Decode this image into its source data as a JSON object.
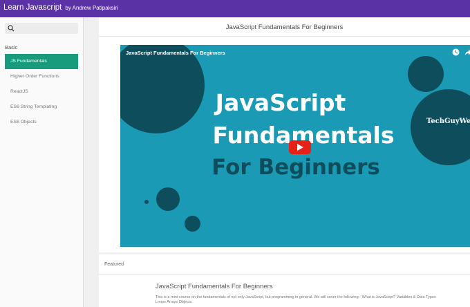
{
  "header": {
    "title": "Learn Javascript",
    "author": "by Andrew Patipaksiri"
  },
  "sidebar": {
    "search_placeholder": "",
    "section_label": "Basic",
    "items": [
      {
        "label": "JS Fundamentals",
        "active": true
      },
      {
        "label": "Higher Order Functions",
        "active": false
      },
      {
        "label": "ReactJS",
        "active": false
      },
      {
        "label": "ES6 String Templating",
        "active": false
      },
      {
        "label": "ES6 Objects",
        "active": false
      }
    ]
  },
  "main": {
    "page_title": "JavaScript Fundamentals For Beginners",
    "video": {
      "title": "JavaScript Fundamentals For Beginners",
      "thumbnail_lines": [
        "JavaScript",
        "Fundamentals",
        "For Beginners"
      ],
      "brand": "TechGuyWeb"
    },
    "featured": {
      "label": "Featured",
      "title": "JavaScript Fundamentals For Beginners",
      "description": "This is a mini-course on the fundamentals of not only JavaScript, but programming in general. We will cover the following - What is JavaScript? Variables & Data Types Loops Arrays Objects."
    }
  },
  "colors": {
    "header": "#5b32a6",
    "accent": "#189b7c",
    "video_bg": "#1a9ab5",
    "video_dark": "#0e4e5c"
  }
}
